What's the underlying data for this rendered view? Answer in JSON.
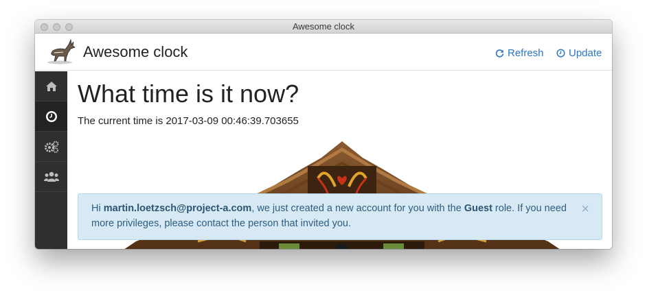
{
  "window": {
    "title": "Awesome clock"
  },
  "header": {
    "app_title": "Awesome clock",
    "refresh_label": "Refresh",
    "update_label": "Update",
    "link_color": "#2a76c6"
  },
  "sidebar": {
    "items": [
      {
        "icon": "home-icon",
        "active": false
      },
      {
        "icon": "clock-icon",
        "active": true
      },
      {
        "icon": "cogs-icon",
        "active": false
      },
      {
        "icon": "users-icon",
        "active": false
      }
    ]
  },
  "main": {
    "title": "What time is it now?",
    "time_prefix": "The current time is ",
    "time_value": "2017-03-09 00:46:39.703655"
  },
  "alert": {
    "hi": "Hi ",
    "email": "martin.loetzsch@project-a.com",
    "mid": ", we just created a new account for you with the ",
    "role": "Guest",
    "tail": " role. If you need more privileges, please contact the person that invited you.",
    "close_glyph": "×"
  }
}
